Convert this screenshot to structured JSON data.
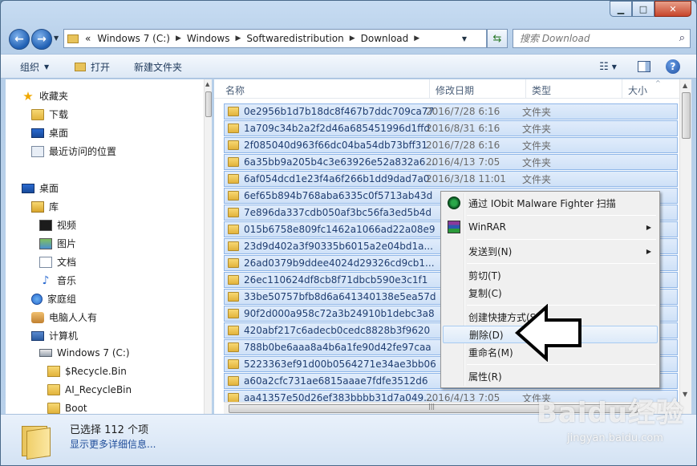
{
  "window": {
    "minimize_glyph": "▁",
    "maximize_glyph": "□",
    "close_glyph": "✕"
  },
  "address": {
    "crumbs": [
      "Windows 7  (C:)",
      "Windows",
      "Softwaredistribution",
      "Download"
    ],
    "prefix": "«"
  },
  "search": {
    "placeholder": "搜索 Download"
  },
  "toolbar": {
    "organize": "组织",
    "open": "打开",
    "new_folder": "新建文件夹"
  },
  "nav": {
    "favorites": "收藏夹",
    "downloads": "下载",
    "desktop_fav": "桌面",
    "recent": "最近访问的位置",
    "desktop": "桌面",
    "libraries": "库",
    "videos": "视频",
    "pictures": "图片",
    "documents": "文档",
    "music": "音乐",
    "homegroup": "家庭组",
    "user": "电脑人人有",
    "computer": "计算机",
    "drive": "Windows 7  (C:)",
    "recycle": "$Recycle.Bin",
    "ai_recycle": "AI_RecycleBin",
    "boot": "Boot"
  },
  "columns": {
    "name": "名称",
    "date": "修改日期",
    "type": "类型",
    "size": "大小"
  },
  "files": [
    {
      "name": "0e2956b1d7b18dc8f467b7ddc709ca77",
      "date": "2016/7/28 6:16",
      "type": "文件夹"
    },
    {
      "name": "1a709c34b2a2f2d46a685451996d1ffd",
      "date": "2016/8/31 6:16",
      "type": "文件夹"
    },
    {
      "name": "2f085040d963f66dc04ba54db73bff31",
      "date": "2016/7/28 6:16",
      "type": "文件夹"
    },
    {
      "name": "6a35bb9a205b4c3e63926e52a832a6...",
      "date": "2016/4/13 7:05",
      "type": "文件夹"
    },
    {
      "name": "6af054dcd1e23f4a6f266b1dd9dad7a0",
      "date": "2016/3/18 11:01",
      "type": "文件夹"
    },
    {
      "name": "6ef65b894b768aba6335c0f5713ab43d",
      "date": "",
      "type": ""
    },
    {
      "name": "7e896da337cdb050af3bc56fa3ed5b4d",
      "date": "",
      "type": ""
    },
    {
      "name": "015b6758e809fc1462a1066ad22a08e9",
      "date": "",
      "type": ""
    },
    {
      "name": "23d9d402a3f90335b6015a2e04bd1a...",
      "date": "",
      "type": ""
    },
    {
      "name": "26ad0379b9ddee4024d29326cd9cb1...",
      "date": "",
      "type": ""
    },
    {
      "name": "26ec110624df8cb8f71dbcb590e3c1f1",
      "date": "",
      "type": ""
    },
    {
      "name": "33be50757bfb8d6a641340138e5ea57d",
      "date": "",
      "type": ""
    },
    {
      "name": "90f2d000a958c72a3b24910b1debc3a8",
      "date": "",
      "type": ""
    },
    {
      "name": "420abf217c6adecb0cedc8828b3f9620",
      "date": "",
      "type": ""
    },
    {
      "name": "788b0be6aaa8a4b6a1fe90d42fe97caa",
      "date": "",
      "type": ""
    },
    {
      "name": "5223363ef91d00b0564271e34ae3bb06",
      "date": "",
      "type": ""
    },
    {
      "name": "a60a2cfc731ae6815aaae7fdfe3512d6",
      "date": "",
      "type": ""
    },
    {
      "name": "aa41357e50d26ef383bbbb31d7a049...",
      "date": "2016/4/13 7:05",
      "type": "文件夹"
    }
  ],
  "context_menu": {
    "iobit": "通过 IObit Malware Fighter 扫描",
    "winrar": "WinRAR",
    "send_to": "发送到(N)",
    "cut": "剪切(T)",
    "copy": "复制(C)",
    "create_shortcut": "创建快捷方式(S)",
    "delete": "删除(D)",
    "rename": "重命名(M)",
    "properties": "属性(R)"
  },
  "details": {
    "selected": "已选择 112 个项",
    "more": "显示更多详细信息..."
  },
  "watermark": {
    "logo": "Baidu经验",
    "url": "jingyan.baidu.com"
  },
  "colors": {
    "selection": "#cfe1f7",
    "selection_border": "#8fb6e8",
    "link": "#1f4d9a",
    "menu_bg": "#f0f0f0"
  }
}
